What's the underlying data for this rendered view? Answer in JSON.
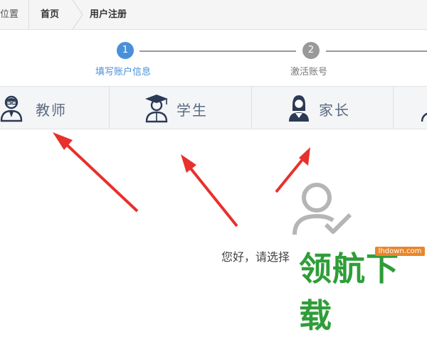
{
  "breadcrumb": {
    "location": "位置",
    "home": "首页",
    "current": "用户注册"
  },
  "steps": [
    {
      "number": "1",
      "label": "填写账户信息",
      "active": true
    },
    {
      "number": "2",
      "label": "激活账号",
      "active": false
    }
  ],
  "roles": [
    {
      "label": "教师",
      "icon": "teacher-icon"
    },
    {
      "label": "学生",
      "icon": "student-icon"
    },
    {
      "label": "家长",
      "icon": "parent-icon"
    },
    {
      "label": "",
      "icon": "user-icon"
    }
  ],
  "empty_state": {
    "icon": "user-check-icon",
    "prompt": "您好，请选择"
  },
  "watermark": {
    "site": "lhdown.com",
    "text": "领航下载"
  },
  "colors": {
    "accent": "#4a90d9",
    "inactive_step": "#999999",
    "role_text": "#5a6a80",
    "annotation_arrow": "#e8302c",
    "watermark_green": "#2f9d38",
    "watermark_badge": "#e8862c"
  }
}
